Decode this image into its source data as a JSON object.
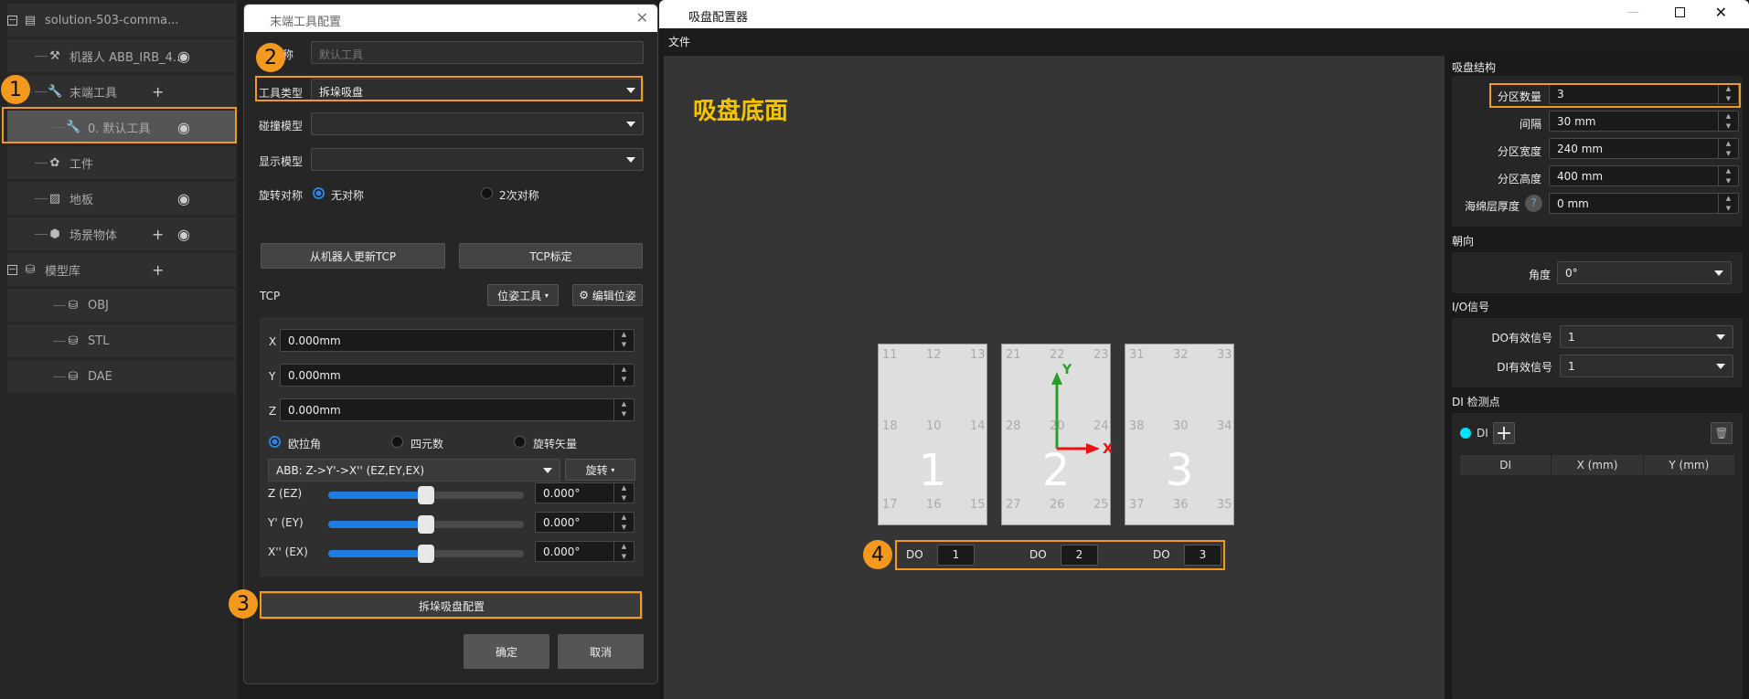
{
  "tree": {
    "items": [
      {
        "label": "solution-503-comma...",
        "icon": "folder-icon",
        "expand": "minus"
      },
      {
        "label": "机器人 ABB_IRB_4...",
        "icon": "robot-arm-icon",
        "eye": true
      },
      {
        "label": "末端工具",
        "icon": "wrench-icon",
        "plus": true
      },
      {
        "label": "0. 默认工具",
        "icon": "wrench-icon",
        "eye": true,
        "selected": true
      },
      {
        "label": "工件",
        "icon": "workpiece-icon"
      },
      {
        "label": "地板",
        "icon": "floor-icon",
        "eye": true
      },
      {
        "label": "场景物体",
        "icon": "scene-object-icon",
        "plus": true,
        "eye": true
      },
      {
        "label": "模型库",
        "icon": "database-icon",
        "plus": true,
        "expand": "minus"
      },
      {
        "label": "OBJ",
        "icon": "database-icon"
      },
      {
        "label": "STL",
        "icon": "database-icon"
      },
      {
        "label": "DAE",
        "icon": "database-icon"
      }
    ]
  },
  "badges": [
    "1",
    "2",
    "3",
    "4"
  ],
  "dialog": {
    "title": "末端工具配置",
    "name_label": "名称",
    "name_placeholder": "默认工具",
    "tool_type_label": "工具类型",
    "tool_type_value": "拆垛吸盘",
    "collision_label": "碰撞模型",
    "collision_value": "",
    "display_label": "显示模型",
    "display_value": "",
    "rot_sym_label": "旋转对称",
    "rot_opt1": "无对称",
    "rot_opt2": "2次对称",
    "update_tcp": "从机器人更新TCP",
    "tcp_calib": "TCP标定",
    "tcp_label": "TCP",
    "pose_tool": "位姿工具",
    "edit_pose": "编辑位姿",
    "x_label": "X",
    "x_value": "0.000mm",
    "y_label": "Y",
    "y_value": "0.000mm",
    "z_label": "Z",
    "z_value": "0.000mm",
    "rep_euler": "欧拉角",
    "rep_quat": "四元数",
    "rep_rotvec": "旋转矢量",
    "euler_conv": "ABB: Z->Y'->X'' (EZ,EY,EX)",
    "rotate": "旋转",
    "angles": [
      {
        "label": "Z (EZ)",
        "value": "0.000°",
        "slider": 0.5
      },
      {
        "label": "Y' (EY)",
        "value": "0.000°",
        "slider": 0.5
      },
      {
        "label": "X'' (EX)",
        "value": "0.000°",
        "slider": 0.5
      }
    ],
    "gripper_config": "拆垛吸盘配置",
    "ok": "确定",
    "cancel": "取消"
  },
  "configurator": {
    "title": "吸盘配置器",
    "menu_file": "文件",
    "canvas_title": "吸盘底面",
    "zones": [
      {
        "label": "1",
        "points": [
          "11",
          "12",
          "13",
          "18",
          "10",
          "14",
          "17",
          "16",
          "15"
        ],
        "do_value": "1"
      },
      {
        "label": "2",
        "points": [
          "21",
          "22",
          "23",
          "28",
          "20",
          "24",
          "27",
          "26",
          "25"
        ],
        "do_value": "2"
      },
      {
        "label": "3",
        "points": [
          "31",
          "32",
          "33",
          "38",
          "30",
          "34",
          "37",
          "36",
          "35"
        ],
        "do_value": "3"
      }
    ],
    "do_label": "DO",
    "axis_x": "X",
    "axis_y": "Y",
    "structure_title": "吸盘结构",
    "zone_count_label": "分区数量",
    "zone_count": "3",
    "gap_label": "间隔",
    "gap": "30 mm",
    "zone_width_label": "分区宽度",
    "zone_width": "240 mm",
    "zone_height_label": "分区高度",
    "zone_height": "400 mm",
    "sponge_label": "海绵层厚度",
    "sponge": "0 mm",
    "orient_title": "朝向",
    "angle_label": "角度",
    "angle": "0°",
    "io_title": "I/O信号",
    "do_valid_label": "DO有效信号",
    "do_valid": "1",
    "di_valid_label": "DI有效信号",
    "di_valid": "1",
    "di_title": "DI 检测点",
    "di_legend": "DI",
    "di_columns": [
      "DI",
      "X (mm)",
      "Y (mm)"
    ]
  },
  "colors": {
    "accent": "#f39a1e",
    "title_yellow": "#f5c400",
    "di_cyan": "#00e5ff",
    "axis_x": "#ee1111",
    "axis_y": "#2a9d2a"
  }
}
